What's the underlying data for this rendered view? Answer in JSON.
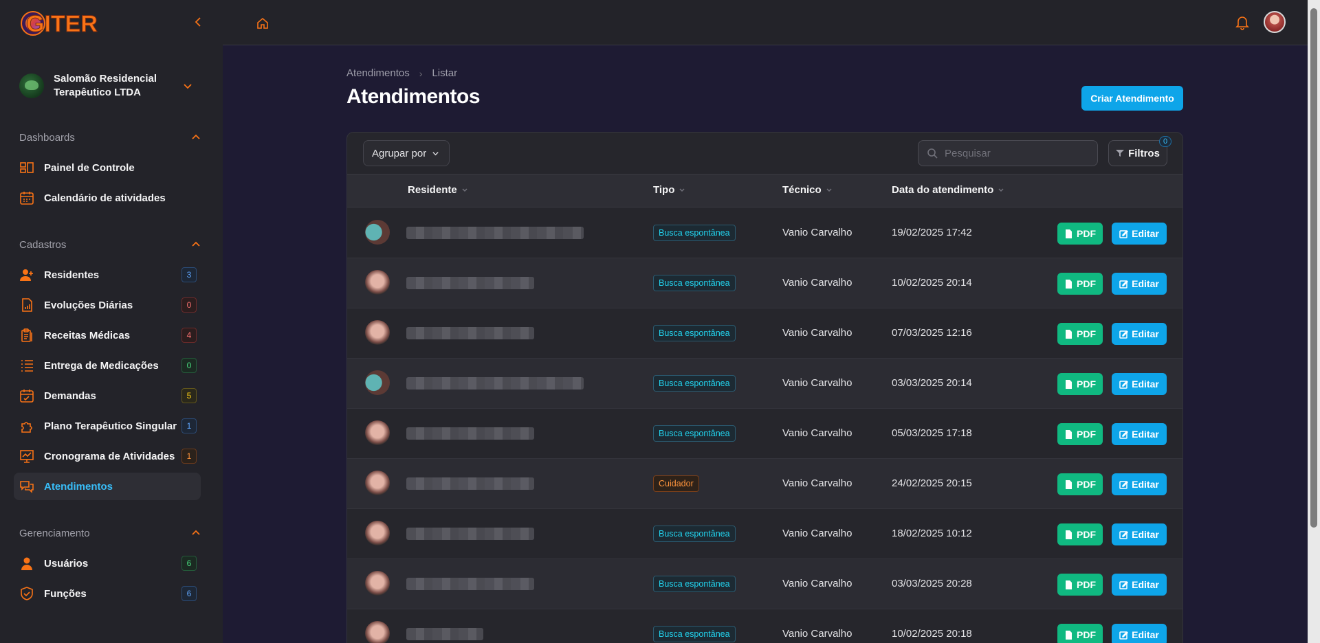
{
  "sidebar": {
    "logo_text": "GITER",
    "org_name": "Salomão Residencial Terapêutico LTDA",
    "sections": [
      {
        "label": "Dashboards"
      },
      {
        "label": "Cadastros"
      },
      {
        "label": "Gerenciamento"
      }
    ],
    "dashboards": [
      {
        "label": "Painel de Controle",
        "icon": "dashboard-icon"
      },
      {
        "label": "Calendário de atividades",
        "icon": "calendar-icon"
      }
    ],
    "cadastros": [
      {
        "label": "Residentes",
        "count": "3",
        "icon": "user-plus-icon"
      },
      {
        "label": "Evoluções Diárias",
        "count": "0",
        "icon": "chart-file-icon"
      },
      {
        "label": "Receitas Médicas",
        "count": "4",
        "icon": "clipboard-icon"
      },
      {
        "label": "Entrega de Medicações",
        "count": "0",
        "icon": "list-icon"
      },
      {
        "label": "Demandas",
        "count": "5",
        "icon": "calendar-check-icon"
      },
      {
        "label": "Plano Terapêutico Singular",
        "count": "1",
        "icon": "puzzle-icon"
      },
      {
        "label": "Cronograma de Atividades",
        "count": "1",
        "icon": "presentation-icon"
      },
      {
        "label": "Atendimentos",
        "icon": "chat-icon"
      }
    ],
    "gerenciamento": [
      {
        "label": "Usuários",
        "count": "6",
        "icon": "user-icon"
      },
      {
        "label": "Funções",
        "count": "6",
        "icon": "shield-icon"
      }
    ]
  },
  "breadcrumb": [
    "Atendimentos",
    "Listar"
  ],
  "page_title": "Atendimentos",
  "create_button": "Criar Atendimento",
  "toolbar": {
    "group_by": "Agrupar por",
    "search_placeholder": "Pesquisar",
    "filters_label": "Filtros",
    "filters_count": "0"
  },
  "table": {
    "headers": [
      "Residente",
      "Tipo",
      "Técnico",
      "Data do atendimento"
    ],
    "pdf_label": "PDF",
    "edit_label": "Editar",
    "rows": [
      {
        "tipo": "Busca espontânea",
        "tecnico": "Vanio Carvalho",
        "data": "19/02/2025 17:42"
      },
      {
        "tipo": "Busca espontânea",
        "tecnico": "Vanio Carvalho",
        "data": "10/02/2025 20:14"
      },
      {
        "tipo": "Busca espontânea",
        "tecnico": "Vanio Carvalho",
        "data": "07/03/2025 12:16"
      },
      {
        "tipo": "Busca espontânea",
        "tecnico": "Vanio Carvalho",
        "data": "03/03/2025 20:14"
      },
      {
        "tipo": "Busca espontânea",
        "tecnico": "Vanio Carvalho",
        "data": "05/03/2025 17:18"
      },
      {
        "tipo": "Cuidador",
        "tecnico": "Vanio Carvalho",
        "data": "24/02/2025 20:15"
      },
      {
        "tipo": "Busca espontânea",
        "tecnico": "Vanio Carvalho",
        "data": "18/02/2025 10:12"
      },
      {
        "tipo": "Busca espontânea",
        "tecnico": "Vanio Carvalho",
        "data": "03/03/2025 20:28"
      },
      {
        "tipo": "Busca espontânea",
        "tecnico": "Vanio Carvalho",
        "data": "10/02/2025 20:18"
      }
    ]
  },
  "colors": {
    "accent": "#f97316",
    "primary": "#0ea5e9",
    "success": "#10b981",
    "background": "#1e1b33"
  }
}
